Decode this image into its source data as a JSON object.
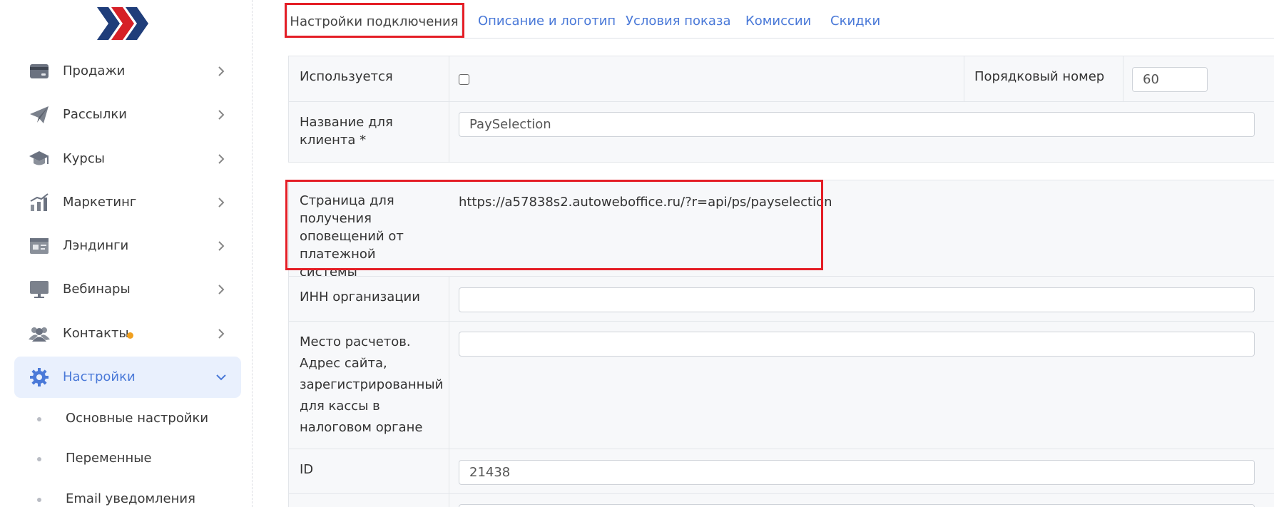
{
  "colors": {
    "accent": "#4a79d8",
    "active_bg": "#e9f0fd",
    "highlight": "#e41e26",
    "notification_dot": "#f0a020",
    "logo_red": "#d62027",
    "logo_navy": "#1f3d7a"
  },
  "sidebar": {
    "logo_icon": "double-chevron-logo",
    "items": [
      {
        "label": "Продажи",
        "icon": "card-icon",
        "expanded": false
      },
      {
        "label": "Рассылки",
        "icon": "paper-plane-icon",
        "expanded": false
      },
      {
        "label": "Курсы",
        "icon": "graduation-cap-icon",
        "expanded": false
      },
      {
        "label": "Маркетинг",
        "icon": "chart-icon",
        "expanded": false
      },
      {
        "label": "Лэндинги",
        "icon": "landing-page-icon",
        "expanded": false
      },
      {
        "label": "Вебинары",
        "icon": "monitor-icon",
        "expanded": false
      },
      {
        "label": "Контакты",
        "icon": "users-icon",
        "expanded": false,
        "has_notification": true
      },
      {
        "label": "Настройки",
        "icon": "gear-icon",
        "expanded": true,
        "active": true
      }
    ],
    "subitems": [
      {
        "label": "Основные настройки"
      },
      {
        "label": "Переменные"
      },
      {
        "label": "Email уведомления"
      }
    ]
  },
  "tabs": [
    {
      "label": "Настройки подключения",
      "active": true
    },
    {
      "label": "Описание и логотип"
    },
    {
      "label": "Условия показа"
    },
    {
      "label": "Комиссии"
    },
    {
      "label": "Скидки"
    }
  ],
  "form": {
    "used": {
      "label": "Используется",
      "checked": false
    },
    "order": {
      "label": "Порядковый номер",
      "value": "60"
    },
    "client_name": {
      "label": "Название для клиента *",
      "value": "PaySelection"
    },
    "notify_page": {
      "label": "Страница для получения оповещений от платежной системы",
      "value": "https://a57838s2.autoweboffice.ru/?r=api/ps/payselection"
    },
    "inn": {
      "label": "ИНН организации",
      "value": ""
    },
    "place": {
      "label": "Место расчетов. Адрес сайта, зарегистрированный для кассы в налоговом органе",
      "value": ""
    },
    "id_field": {
      "label": "ID",
      "value": "21438"
    },
    "next_field": {
      "value": ""
    }
  }
}
